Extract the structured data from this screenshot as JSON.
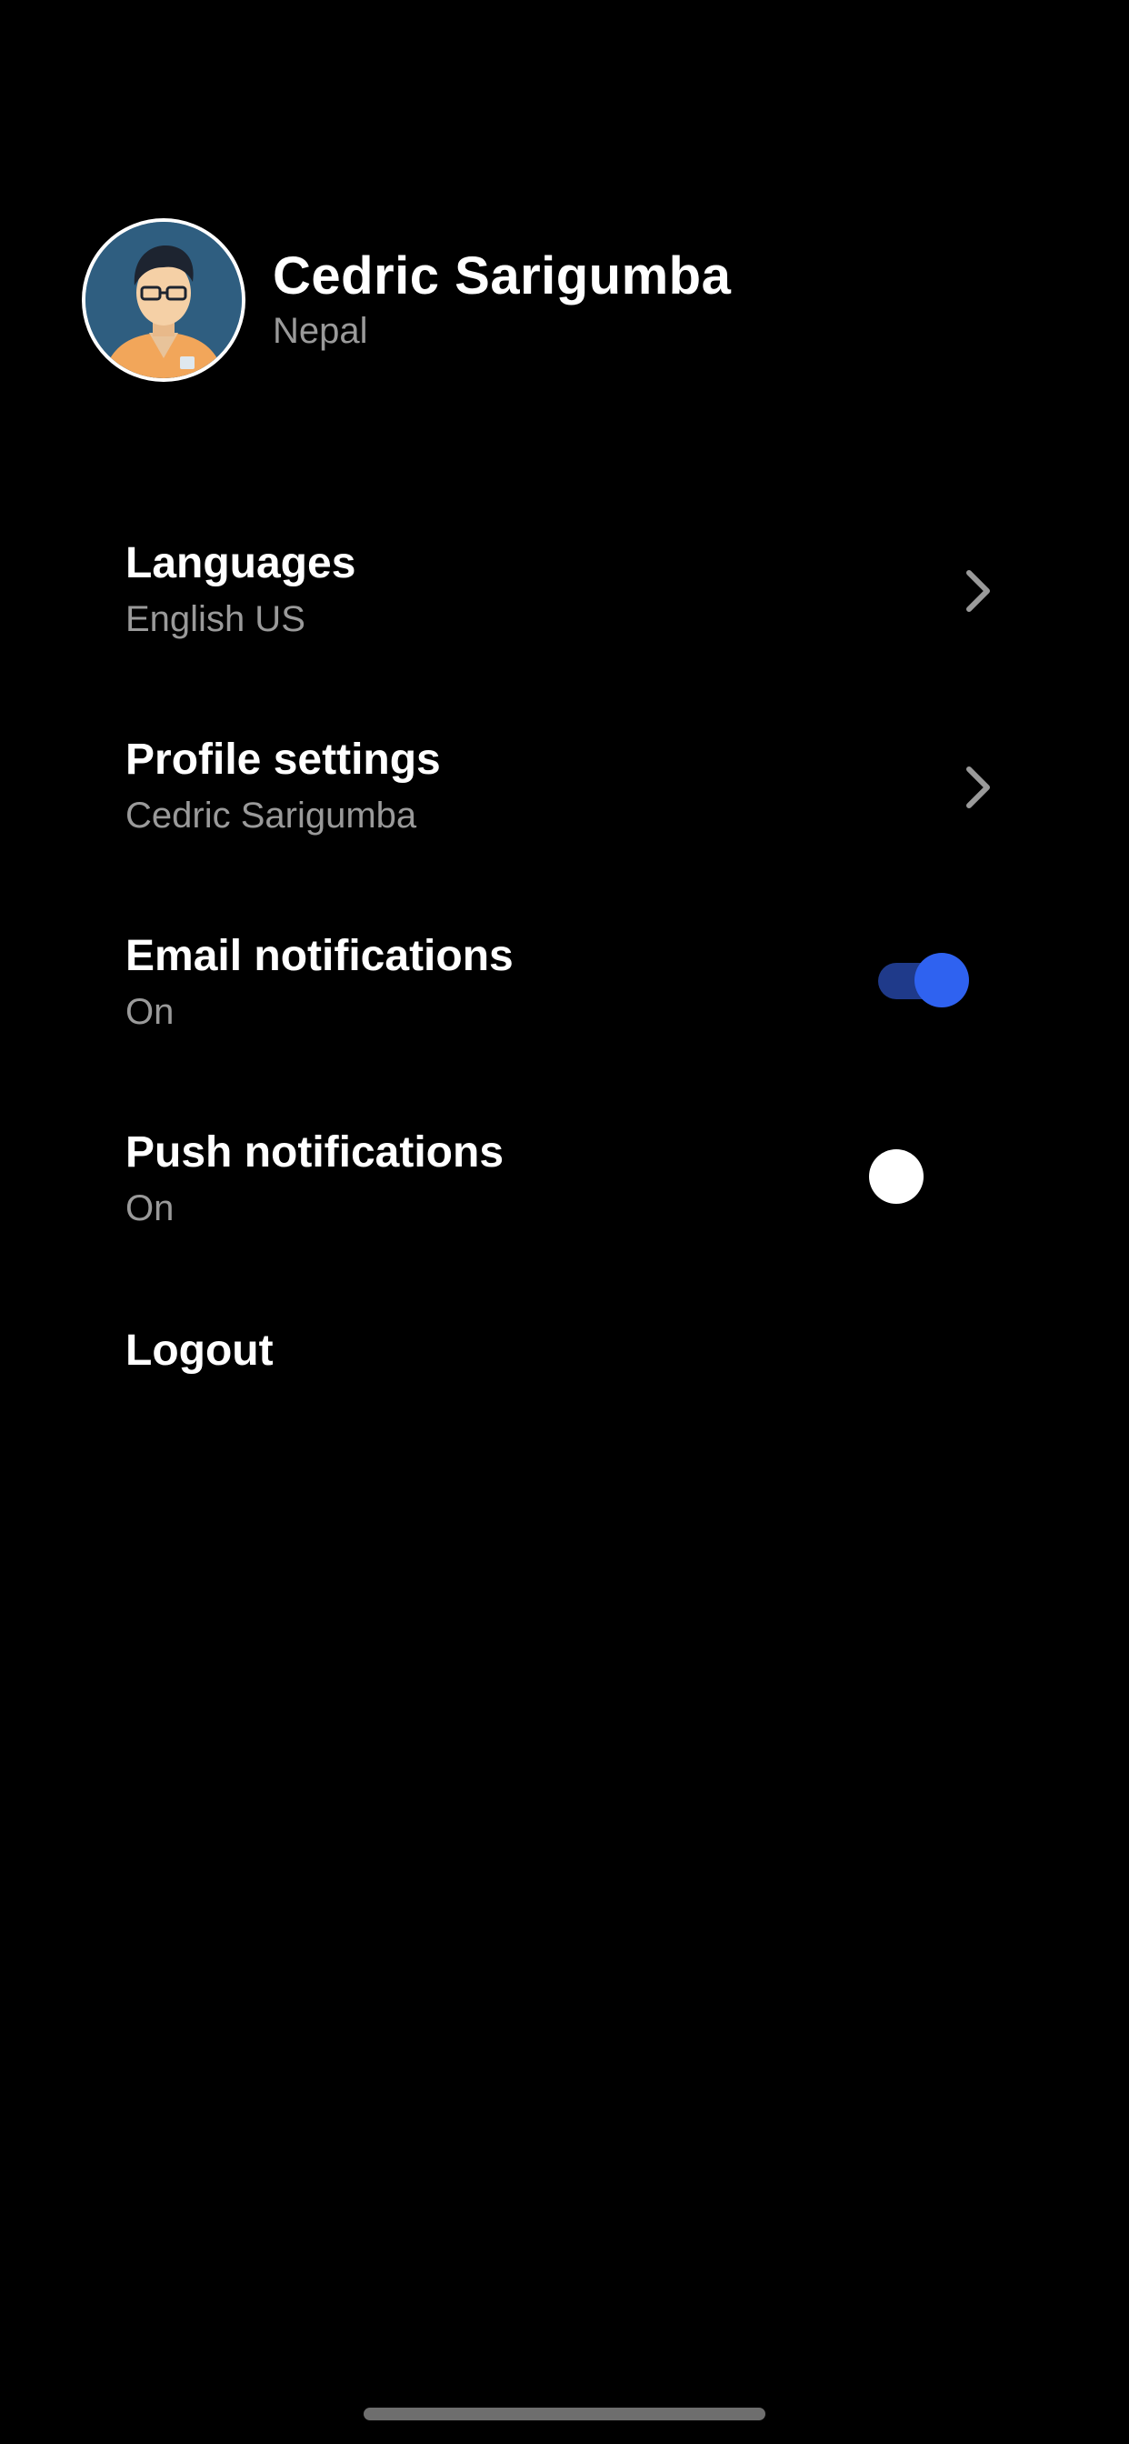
{
  "profile": {
    "name": "Cedric Sarigumba",
    "location": "Nepal",
    "avatar_icon": "user-avatar-icon"
  },
  "settings": [
    {
      "title": "Languages",
      "value": "English US",
      "control": "chevron"
    },
    {
      "title": "Profile settings",
      "value": "Cedric Sarigumba",
      "control": "chevron"
    },
    {
      "title": "Email notifications",
      "value": "On",
      "control": "toggle",
      "toggle_on": true
    },
    {
      "title": "Push notifications",
      "value": "On",
      "control": "toggle",
      "toggle_on": false
    }
  ],
  "logout_label": "Logout",
  "colors": {
    "background": "#000000",
    "text_primary": "#ffffff",
    "text_secondary": "#9a9a9a",
    "toggle_on_track": "#1f3a8a",
    "toggle_on_thumb": "#2f62f0",
    "toggle_off_thumb": "#ffffff",
    "chevron": "#9a9a9a"
  }
}
